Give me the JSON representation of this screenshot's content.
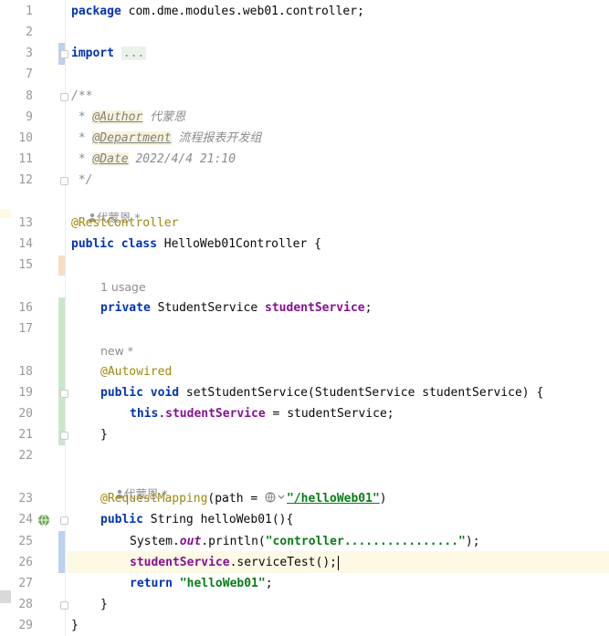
{
  "gutter": {
    "line_numbers": [
      "1",
      "2",
      "3",
      "7",
      "8",
      "9",
      "10",
      "11",
      "12",
      "13",
      "14",
      "15",
      "16",
      "17",
      "18",
      "19",
      "20",
      "21",
      "22",
      "23",
      "24",
      "25",
      "26",
      "27",
      "28",
      "29"
    ]
  },
  "code": {
    "package_kw": "package",
    "package_name": " com.dme.modules.web01.controller;",
    "import_kw": "import",
    "import_dots": "...",
    "doc_open": "/**",
    "doc_star": " * ",
    "doc_author_tag": "@Author",
    "doc_author_val": " 代蒙恩",
    "doc_dept_tag": "@Department",
    "doc_dept_val": " 流程报表开发组",
    "doc_date_tag": "@Date",
    "doc_date_val": " 2022/4/4 21:10",
    "doc_close": " */",
    "rest_controller": "@RestController",
    "public_kw": "public",
    "class_kw": " class",
    "class_name": " HelloWeb01Controller {",
    "private_kw": "private",
    "field_type": " StudentService ",
    "field_name": "studentService",
    "semicolon": ";",
    "autowired": "@Autowired",
    "void_kw": " void",
    "setter_sig": " setStudentService(StudentService studentService) {",
    "this_kw": "this",
    "dot": ".",
    "assign_rhs": " = studentService;",
    "close_brace": "}",
    "request_mapping": "@RequestMapping",
    "rm_args_open": "(path = ",
    "rm_path": "\"/helloWeb01\"",
    "rm_args_close": ")",
    "method_sig": " String helloWeb01(){",
    "system": "System.",
    "out": "out",
    "println": ".println(",
    "println_str": "\"controller................\"",
    "println_close": ");",
    "service_call": ".serviceTest();",
    "return_kw": "return",
    "return_str": " \"helloWeb01\"",
    "final_brace": "}"
  },
  "hints": {
    "author_class": "代蒙恩 *",
    "usage": "1 usage",
    "new_hint": "new *",
    "author_method": "代蒙恩 *"
  },
  "colors": {
    "keyword": "#0033b3",
    "annotation": "#9e880d",
    "field": "#871094",
    "string": "#067d17",
    "comment": "#8c8c8c",
    "added_bar": "#c9e7c9",
    "modified_bar": "#bcd1ee",
    "caret_line": "#fdf9e4"
  }
}
